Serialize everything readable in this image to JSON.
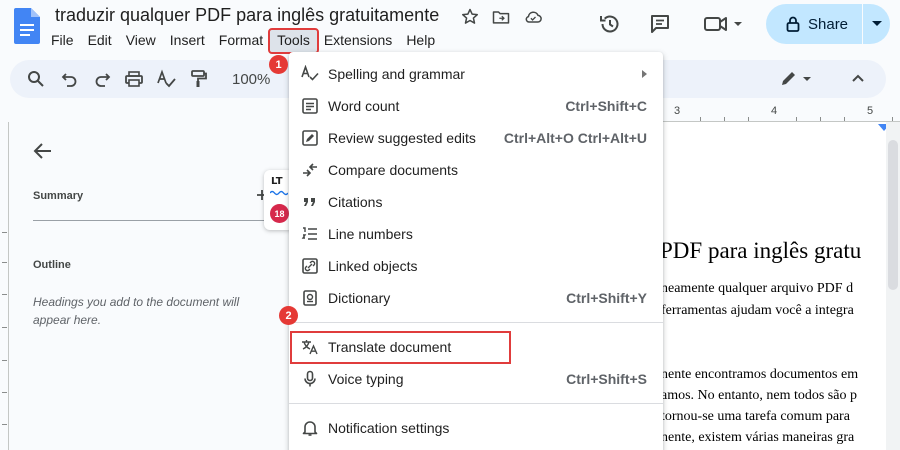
{
  "document": {
    "title": "traduzir qualquer PDF para inglês gratuitamente",
    "heading": "PDF para inglês gratu",
    "paragraph1": [
      "neamente qualquer arquivo PDF d",
      "ferramentas ajudam você a integra"
    ],
    "paragraph2": [
      "nente encontramos documentos em",
      "amos. No entanto, nem todos são p",
      "tornou-se uma tarefa comum para",
      "nente, existem várias maneiras gra"
    ]
  },
  "menubar": [
    "File",
    "Edit",
    "View",
    "Insert",
    "Format",
    "Tools",
    "Extensions",
    "Help"
  ],
  "active_menu": "Tools",
  "header": {
    "share_label": "Share"
  },
  "toolbar": {
    "zoom": "100%"
  },
  "ruler": {
    "numbers": [
      "3",
      "4",
      "5"
    ]
  },
  "outline_pane": {
    "summary_label": "Summary",
    "outline_label": "Outline",
    "empty_note": "Headings you add to the document will appear here."
  },
  "languagetool": {
    "logo_text": "LT",
    "badge_count": "18"
  },
  "tools_menu": {
    "items": [
      {
        "label": "Spelling and grammar",
        "shortcut": "",
        "icon": "spellcheck-icon",
        "submenu": true
      },
      {
        "label": "Word count",
        "shortcut": "Ctrl+Shift+C",
        "icon": "word-count-icon"
      },
      {
        "label": "Review suggested edits",
        "shortcut": "Ctrl+Alt+O Ctrl+Alt+U",
        "icon": "review-edits-icon"
      },
      {
        "label": "Compare documents",
        "shortcut": "",
        "icon": "compare-icon"
      },
      {
        "label": "Citations",
        "shortcut": "",
        "icon": "quote-icon"
      },
      {
        "label": "Line numbers",
        "shortcut": "",
        "icon": "line-numbers-icon"
      },
      {
        "label": "Linked objects",
        "shortcut": "",
        "icon": "linked-objects-icon"
      },
      {
        "label": "Dictionary",
        "shortcut": "Ctrl+Shift+Y",
        "icon": "dictionary-icon"
      },
      {
        "label": "Translate document",
        "shortcut": "",
        "icon": "translate-icon"
      },
      {
        "label": "Voice typing",
        "shortcut": "Ctrl+Shift+S",
        "icon": "microphone-icon"
      },
      {
        "label": "Notification settings",
        "shortcut": "",
        "icon": "bell-icon"
      }
    ]
  },
  "annotations": {
    "step1": "1",
    "step2": "2"
  },
  "colors": {
    "accent": "#c2e7ff",
    "highlight_outline": "#e03c3c",
    "badge_red": "#e53935",
    "docs_blue": "#4285f4"
  }
}
